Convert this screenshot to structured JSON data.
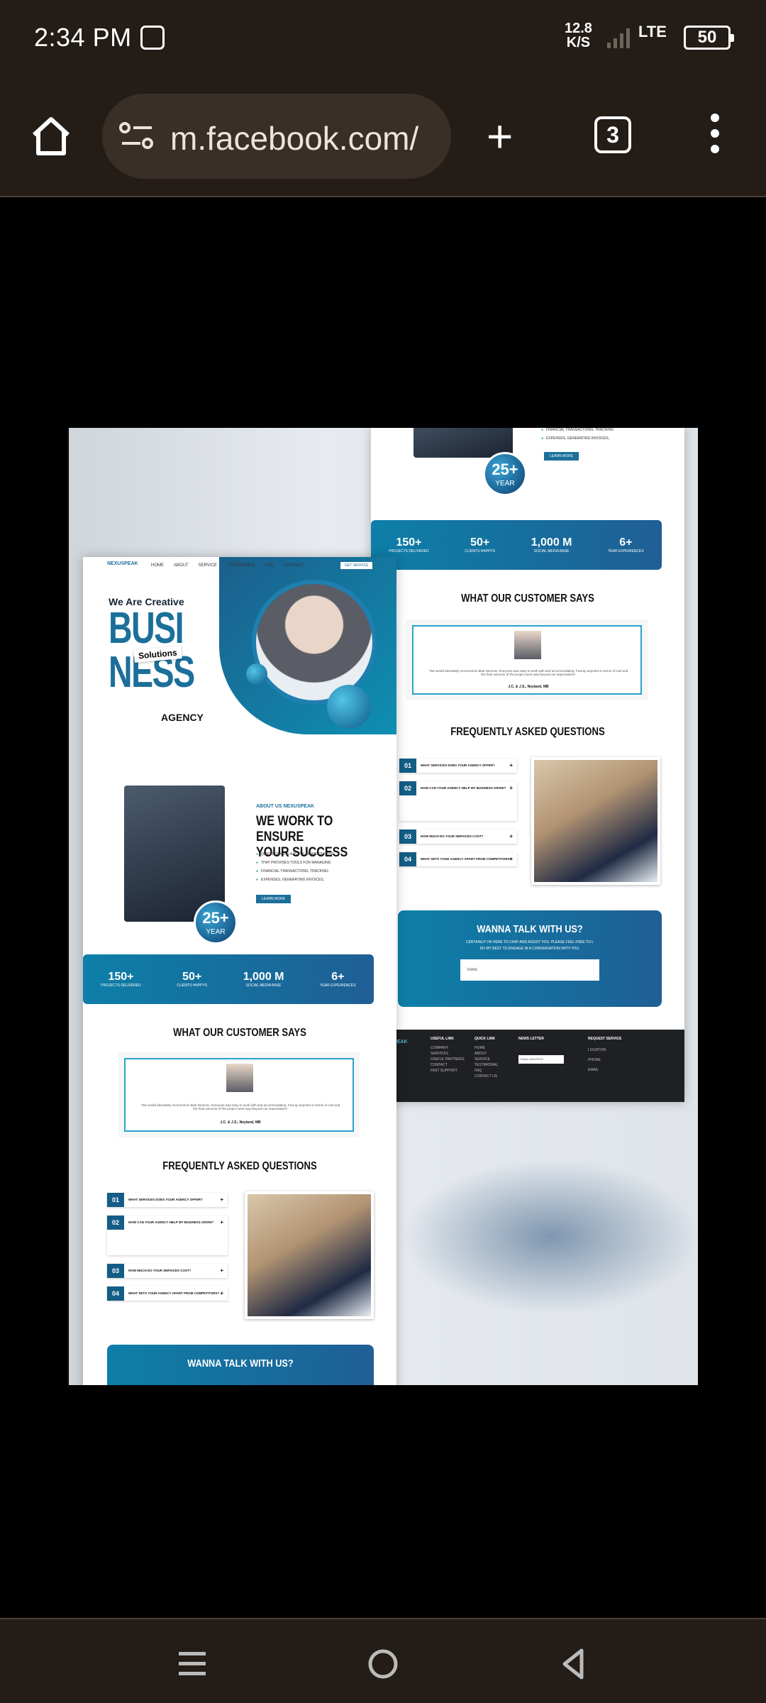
{
  "status_bar": {
    "time": "2:34 PM",
    "net_speed_value": "12.8",
    "net_speed_unit": "K/S",
    "network": "LTE",
    "battery": "50"
  },
  "browser": {
    "url": "m.facebook.com/",
    "tab_count": "3"
  },
  "left_page": {
    "nav_logo": "NEXUSPEAK",
    "nav_links": [
      "HOME",
      "ABOUT",
      "SERVICE",
      "TESTIMONIAL",
      "FAQ",
      "CONTACT"
    ],
    "nav_button": "GET SERVICE",
    "hero": {
      "we_are": "We Are Creative",
      "line1": "BUSI",
      "solutions": "Solutions",
      "line2": "NESS",
      "agency": "AGENCY"
    },
    "about": {
      "eyebrow": "ABOUT US NEXUSPEAK",
      "heading1": "WE WORK TO ENSURE",
      "heading2": "YOUR SUCCESS",
      "bullets": [
        "QUICKBOOKS IS A POPULAR ACCOUNTING",
        "THAT PROVIDES TOOLS FOR MANAGING",
        "FINANCIAL TRANSACTIONS, TRACKING",
        "EXPENSES, GENERATING INVOICES,"
      ],
      "button": "LEARN MORE",
      "badge_num": "25+",
      "badge_label": "YEAR"
    },
    "stats": [
      {
        "n": "150+",
        "l": "PROJECTS DELIVERED"
      },
      {
        "n": "50+",
        "l": "CLIENTS HAPPYS"
      },
      {
        "n": "1,000 M",
        "l": "SOCIAL MEDIA BASE"
      },
      {
        "n": "6+",
        "l": "YEAR EXPERIENCES"
      }
    ],
    "testimonial_title": "WHAT OUR CUSTOMER SAYS",
    "testimonial_quote": "\"We would absolutely recommend Ideal Nomnov. Everyone was easy to work with and accommodating. Facing surprises in terms of cost and the final outcome of the project went way beyond our expectations\"",
    "testimonial_name": "J.C. & J.S., Neyland, MB",
    "faq_title": "FREQUENTLY ASKED QUESTIONS",
    "faq": [
      {
        "num": "01",
        "q": "WHAT SERVICES DOES YOUR AGENCY OFFER?"
      },
      {
        "num": "02",
        "q": "HOW CAN YOUR AGENCY HELP MY BUSINESS GROW?"
      },
      {
        "num": "03",
        "q": "HOW MUCH DO YOUR SERVICES COST?"
      },
      {
        "num": "04",
        "q": "WHAT SETS YOUR AGENCY APART FROM COMPETITORS?"
      }
    ],
    "talk_title": "WANNA TALK WITH US?"
  },
  "right_page": {
    "top_bullets": [
      "FINANCIAL TRANSACTIONS, TRACKING",
      "EXPENSES, GENERATING INVOICES,"
    ],
    "button": "LEARN MORE",
    "badge_num": "25+",
    "badge_label": "YEAR",
    "talk_sub1": "CERTAINLY! I'M HERE TO CHAT AND ASSIST YOU. PLEASE FEEL FREE TO L",
    "talk_sub2": "DO MY BEST TO ENGAGE IN A CONVERSATION WITH YOU.",
    "email_placeholder": "EMAIL",
    "footer": {
      "logo": "NEXUSPEAK",
      "cols": [
        "USEFUL LINK",
        "QUICK LINK",
        "NEWS LETTER",
        "REQUEST SERVICE"
      ],
      "useful": [
        "COMPANY",
        "SERVICES",
        "USEFUL PARTNERS",
        "CONTACT",
        "FAST SUPPORT"
      ],
      "quick": [
        "HOME",
        "ABOUT",
        "SERVICE",
        "TESTIMONIAL",
        "FAQ",
        "CONTACT US"
      ],
      "news_placeholder": "EMAIL ADDRESS",
      "req_labels": [
        "LOCATION",
        "PHONE",
        "EMAIL"
      ]
    }
  },
  "colors": {
    "brand": "#1b6f9a",
    "accent": "#0d7fa8",
    "chrome": "#231c17"
  }
}
